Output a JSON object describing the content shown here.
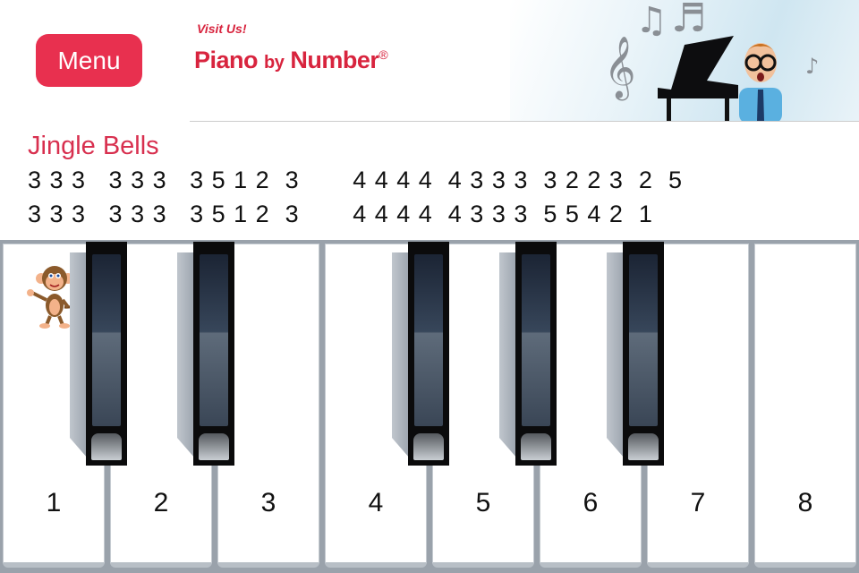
{
  "header": {
    "menu_label": "Menu",
    "visit_label": "Visit Us!",
    "logo": {
      "word1": "Piano",
      "word2": "by",
      "word3": "Number",
      "mark": "®"
    },
    "banner_image": "boy-with-piano-and-music-notes"
  },
  "song": {
    "title": "Jingle Bells",
    "lines": [
      "3 3 3   3 3 3   3 5 1 2  3       4 4 4 4  4 3 3 3  3 2 2 3  2  5",
      "3 3 3   3 3 3   3 5 1 2  3       4 4 4 4  4 3 3 3  5 5 4 2  1"
    ]
  },
  "keyboard": {
    "white_keys": [
      "1",
      "2",
      "3",
      "4",
      "5",
      "6",
      "7",
      "8"
    ],
    "black_key_count": 5,
    "mascot": "monkey",
    "colors": {
      "accent": "#e8304f",
      "title": "#d8304f"
    }
  }
}
